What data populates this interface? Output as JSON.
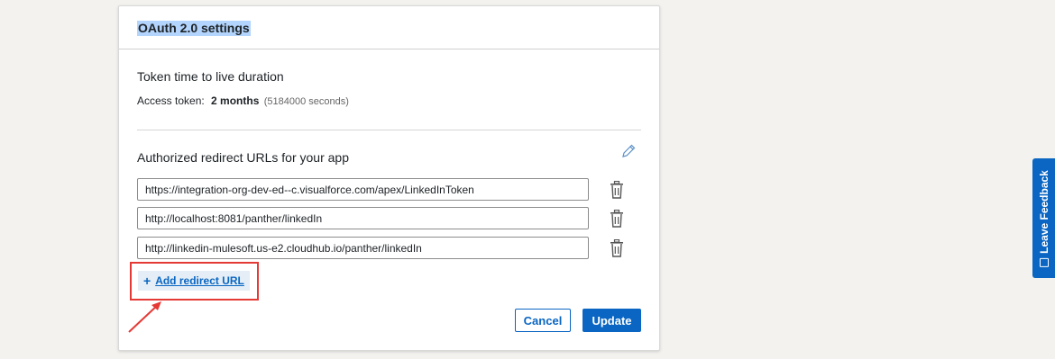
{
  "card": {
    "title": "OAuth 2.0 settings",
    "token_section": {
      "heading": "Token time to live duration",
      "access_label": "Access token:",
      "access_value": "2 months",
      "access_seconds": "(5184000 seconds)"
    },
    "redirect_section": {
      "heading": "Authorized redirect URLs for your app",
      "urls": [
        "https://integration-org-dev-ed--c.visualforce.com/apex/LinkedInToken",
        "http://localhost:8081/panther/linkedIn",
        "http://linkedin-mulesoft.us-e2.cloudhub.io/panther/linkedIn"
      ],
      "add_label": "Add redirect URL",
      "add_icon": "+"
    },
    "actions": {
      "cancel_label": "Cancel",
      "update_label": "Update"
    }
  },
  "feedback": {
    "label": "Leave Feedback"
  },
  "colors": {
    "brand_blue": "#0a66c2",
    "annotation_red": "#e53935",
    "selection_highlight": "#b3d4fc"
  }
}
